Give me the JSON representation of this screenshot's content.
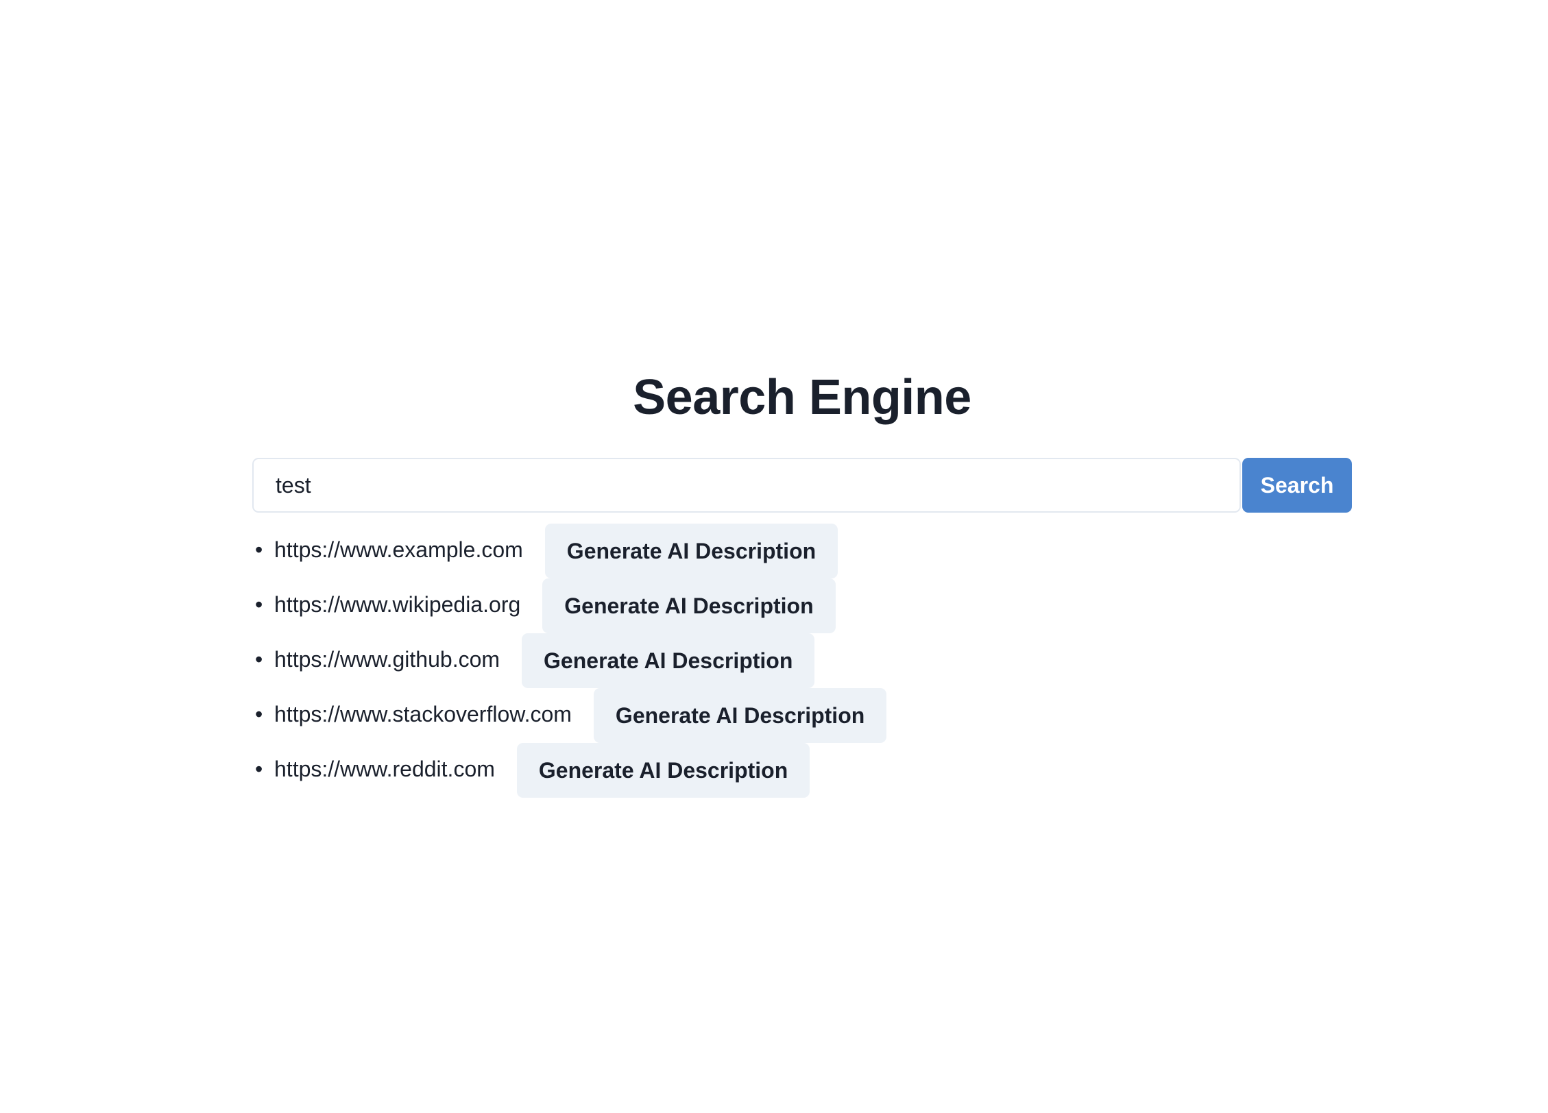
{
  "page": {
    "title": "Search Engine"
  },
  "search": {
    "value": "test",
    "button_label": "Search"
  },
  "results": [
    {
      "url": "https://www.example.com",
      "action_label": "Generate AI Description"
    },
    {
      "url": "https://www.wikipedia.org",
      "action_label": "Generate AI Description"
    },
    {
      "url": "https://www.github.com",
      "action_label": "Generate AI Description"
    },
    {
      "url": "https://www.stackoverflow.com",
      "action_label": "Generate AI Description"
    },
    {
      "url": "https://www.reddit.com",
      "action_label": "Generate AI Description"
    }
  ],
  "colors": {
    "primary": "#4a84cf",
    "secondary_button": "#edf2f7",
    "text": "#1a202c",
    "input_border": "#e2e8f0"
  }
}
